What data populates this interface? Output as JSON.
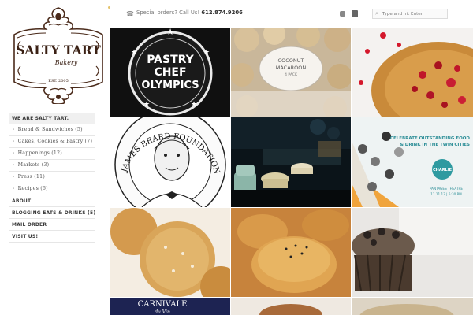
{
  "brand": {
    "name_line1": "SALTY TART",
    "name_line2": "Bakery",
    "est": "EST. 2005"
  },
  "header": {
    "phone_label": "Special orders? Call Us!",
    "phone_number": "612.874.9206",
    "search_placeholder": "Type and hit Enter",
    "icons": [
      "phone-icon",
      "social-icon",
      "social-icon",
      "search-icon"
    ]
  },
  "nav": {
    "items": [
      {
        "label": "WE ARE SALTY TART.",
        "type": "top"
      },
      {
        "label": "Bread & Sandwiches (5)",
        "type": "sub"
      },
      {
        "label": "Cakes, Cookies & Pastry (7)",
        "type": "sub"
      },
      {
        "label": "Happenings (12)",
        "type": "sub"
      },
      {
        "label": "Markets (3)",
        "type": "sub"
      },
      {
        "label": "Press (11)",
        "type": "sub"
      },
      {
        "label": "Recipes (6)",
        "type": "sub"
      },
      {
        "label": "ABOUT",
        "type": "top"
      },
      {
        "label": "BLOGGING EATS & DRINKS (5)",
        "type": "top"
      },
      {
        "label": "MAIL ORDER",
        "type": "top"
      },
      {
        "label": "VISIT US!",
        "type": "top"
      }
    ]
  },
  "tiles": {
    "t1": {
      "line1": "PASTRY",
      "line2": "CHEF",
      "line3": "OLYMPICS"
    },
    "t2": {
      "line1": "COCONUT",
      "line2": "MACAROON",
      "line3": "4 PACK"
    },
    "t4": {
      "ring": "JAMES BEARD FOUNDATION AWARD FOR EXCELLENCE"
    },
    "t6": {
      "line1": "CELEBRATE OUTSTANDING FOOD",
      "line2": "& DRINK IN THE TWIN CITIES",
      "badge": "CHARLIE",
      "footer1": "PANTAGES THEATRE",
      "footer2": "11.11.13  |  5:30 PM"
    },
    "t10": {
      "line1": "CARNIVALE",
      "line2": "du Vin"
    }
  },
  "colors": {
    "accent_gold": "#e4c36b",
    "logo_brown": "#4a2a1a",
    "teal": "#2e9aa0",
    "orange": "#f08a2a"
  }
}
